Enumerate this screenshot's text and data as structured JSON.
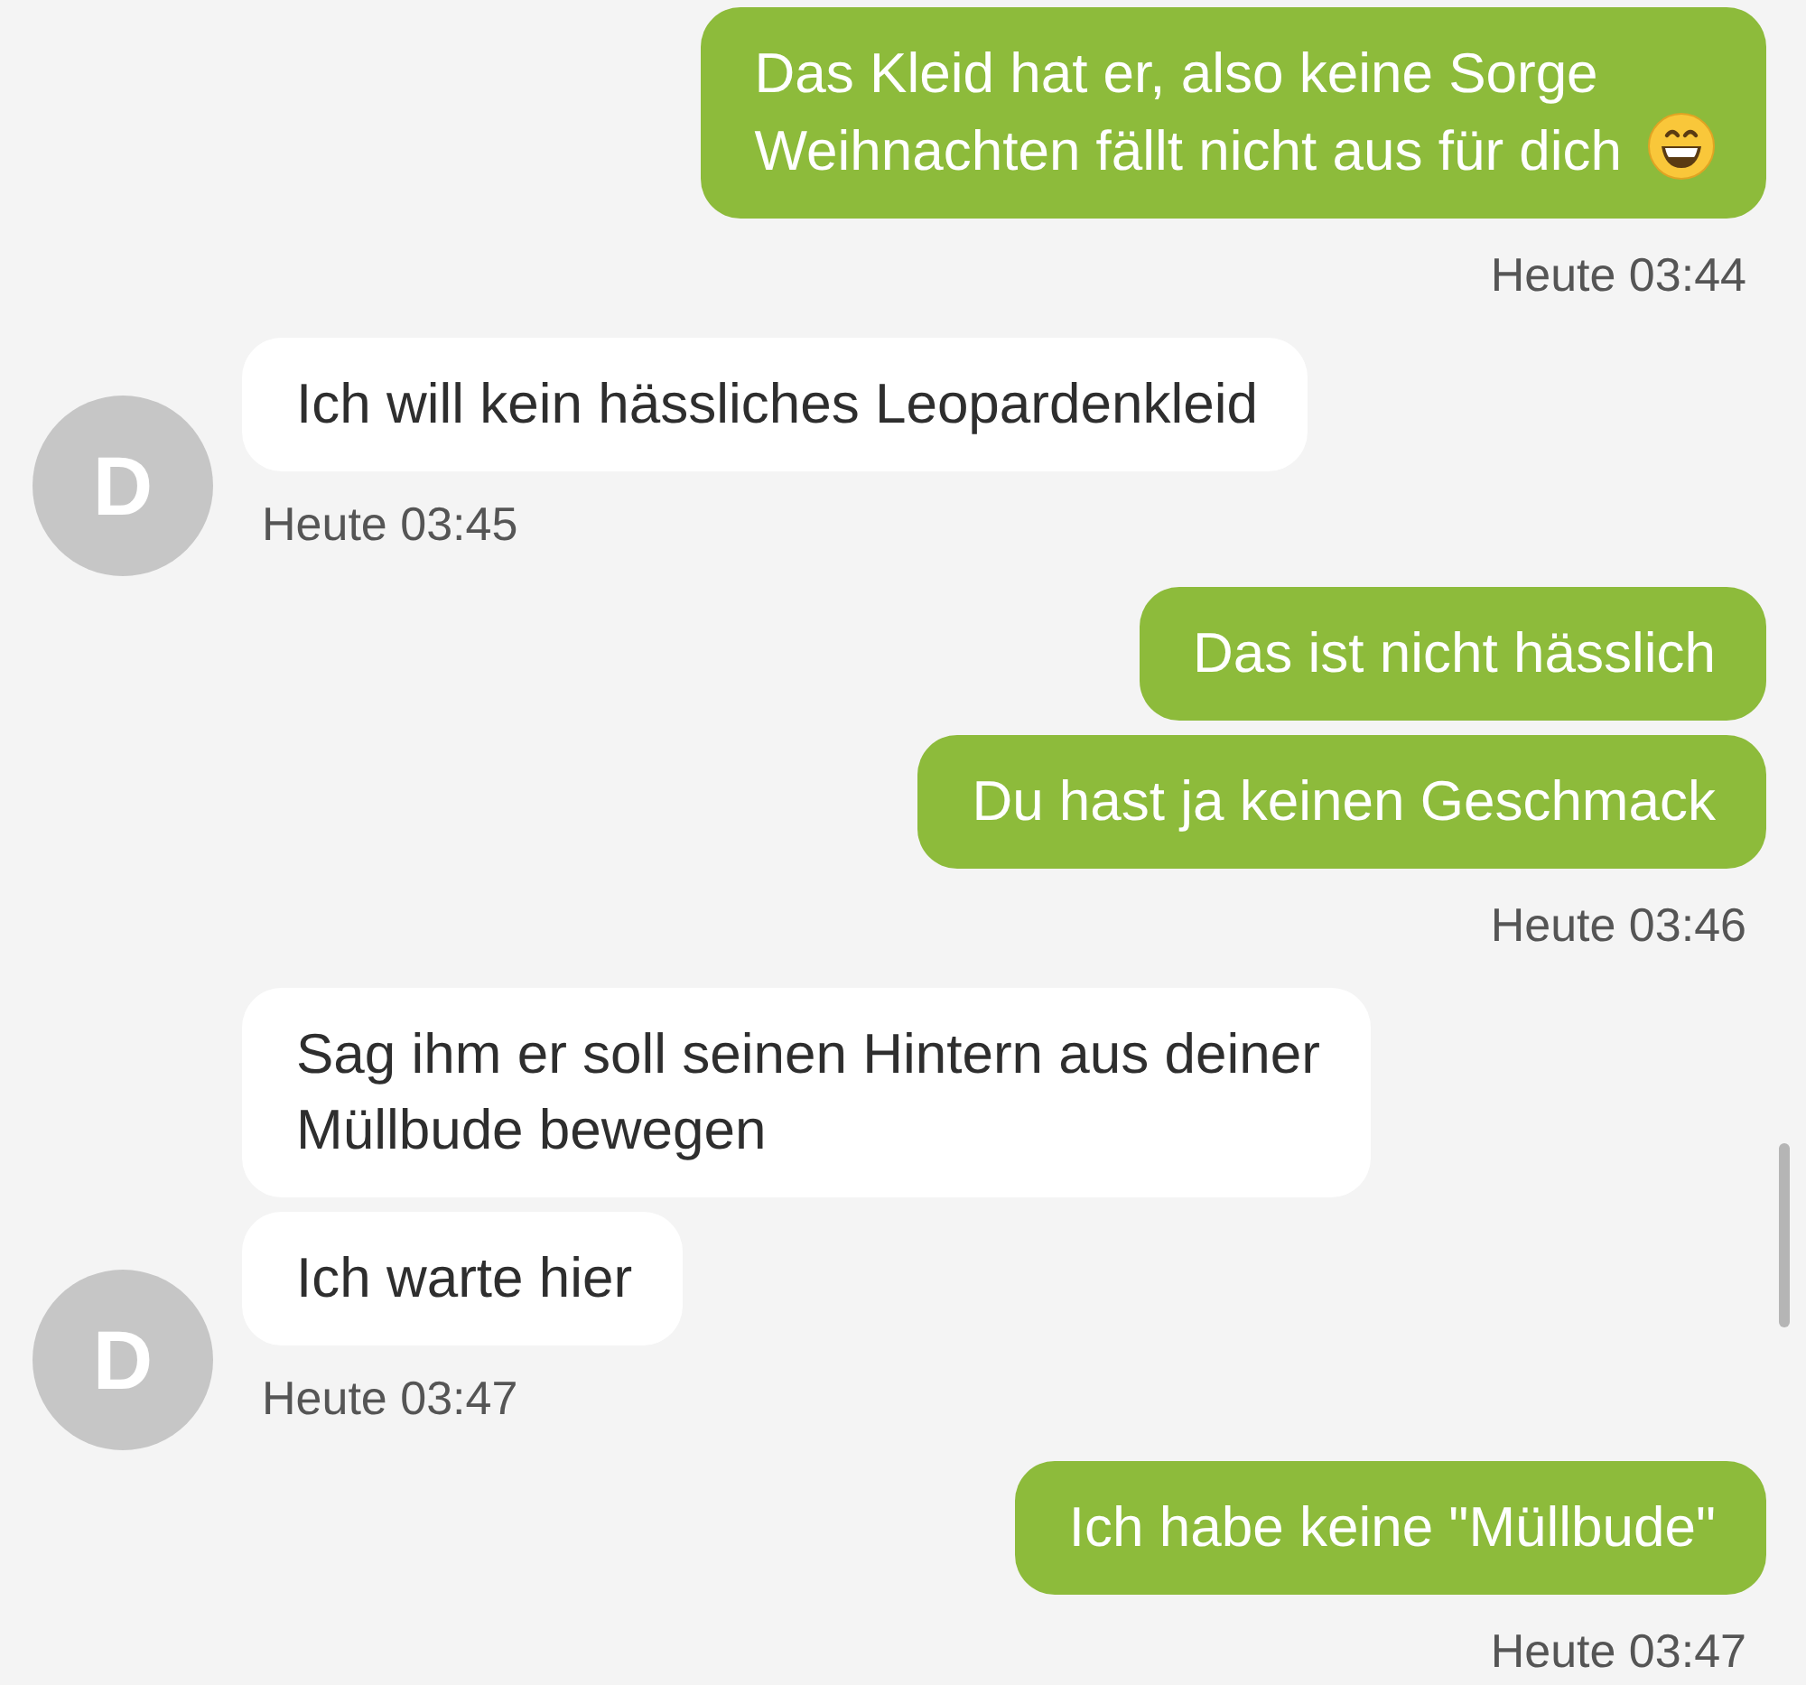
{
  "messages": [
    {
      "kind": "outgoing",
      "bubbles": [
        {
          "text": "Das Kleid hat er, also keine Sorge\nWeihnachten fällt nicht aus für dich",
          "emoji": true
        }
      ],
      "time": "Heute 03:44"
    },
    {
      "kind": "incoming",
      "avatar": "D",
      "bubbles": [
        {
          "text": "Ich will kein hässliches Leopardenkleid"
        }
      ],
      "time": "Heute 03:45"
    },
    {
      "kind": "outgoing",
      "bubbles": [
        {
          "text": "Das ist nicht hässlich"
        },
        {
          "text": "Du hast ja keinen Geschmack"
        }
      ],
      "time": "Heute 03:46"
    },
    {
      "kind": "incoming",
      "avatar": "D",
      "bubbles": [
        {
          "text": "Sag ihm er soll seinen Hintern aus deiner\nMüllbude bewegen"
        },
        {
          "text": "Ich warte hier"
        }
      ],
      "time": "Heute 03:47"
    },
    {
      "kind": "outgoing",
      "bubbles": [
        {
          "text": "Ich habe keine \"Müllbude\""
        }
      ],
      "time": "Heute 03:47"
    }
  ]
}
